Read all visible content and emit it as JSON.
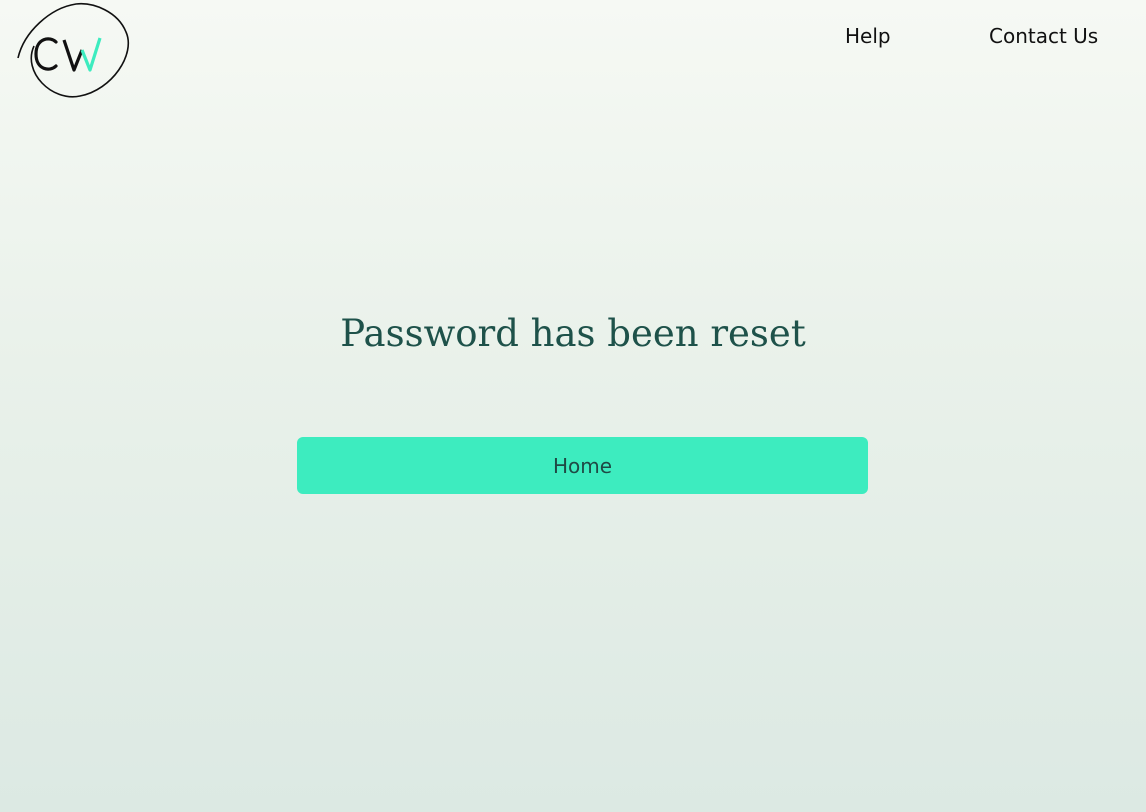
{
  "header": {
    "logo_text": "CW",
    "nav": {
      "help_label": "Help",
      "contact_label": "Contact Us"
    }
  },
  "main": {
    "title": "Password has been reset",
    "home_button_label": "Home"
  },
  "colors": {
    "accent": "#3decbf",
    "title_text": "#1e524a",
    "button_text": "#1f4a45",
    "logo_dark": "#111111"
  }
}
